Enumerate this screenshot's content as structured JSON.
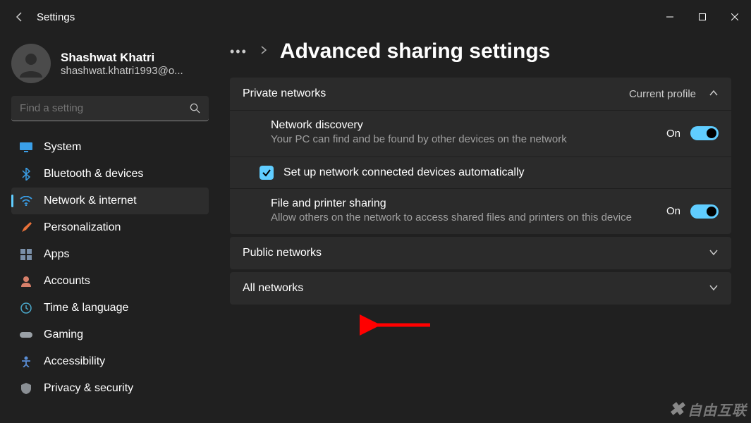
{
  "app_title": "Settings",
  "user": {
    "name": "Shashwat Khatri",
    "email": "shashwat.khatri1993@o..."
  },
  "search": {
    "placeholder": "Find a setting"
  },
  "nav": [
    {
      "label": "System",
      "icon": "monitor",
      "color": "#3a9fe8"
    },
    {
      "label": "Bluetooth & devices",
      "icon": "bluetooth",
      "color": "#3a9fe8"
    },
    {
      "label": "Network & internet",
      "icon": "wifi",
      "color": "#3a9fe8",
      "active": true
    },
    {
      "label": "Personalization",
      "icon": "brush",
      "color": "#e8713a"
    },
    {
      "label": "Apps",
      "icon": "apps",
      "color": "#7a8fa8"
    },
    {
      "label": "Accounts",
      "icon": "person",
      "color": "#d8806a"
    },
    {
      "label": "Time & language",
      "icon": "clock",
      "color": "#4aa6c7"
    },
    {
      "label": "Gaming",
      "icon": "gamepad",
      "color": "#9aa0a6"
    },
    {
      "label": "Accessibility",
      "icon": "access",
      "color": "#5a8ed6"
    },
    {
      "label": "Privacy & security",
      "icon": "shield",
      "color": "#8a8f94"
    }
  ],
  "breadcrumb": {
    "ellipsis": "•••",
    "title": "Advanced sharing settings"
  },
  "sections": {
    "private": {
      "title": "Private networks",
      "profile_tag": "Current profile",
      "expanded": true,
      "items": {
        "discovery": {
          "title": "Network discovery",
          "desc": "Your PC can find and be found by other devices on the network",
          "state": "On"
        },
        "auto_setup": {
          "label": "Set up network connected devices automatically",
          "checked": true
        },
        "sharing": {
          "title": "File and printer sharing",
          "desc": "Allow others on the network to access shared files and printers on this device",
          "state": "On"
        }
      }
    },
    "public": {
      "title": "Public networks",
      "expanded": false
    },
    "all": {
      "title": "All networks",
      "expanded": false
    }
  },
  "annotation": {
    "arrow_color": "#ff0000"
  },
  "watermark": "自由互联"
}
